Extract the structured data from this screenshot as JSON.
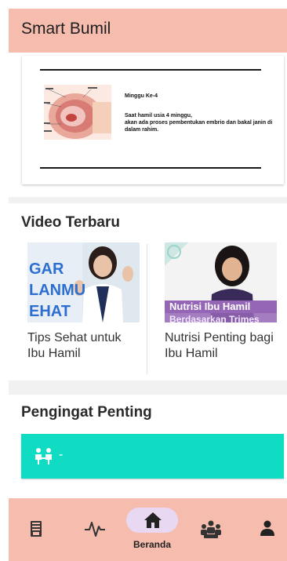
{
  "app": {
    "title": "Smart Bumil"
  },
  "article": {
    "week_title": "Minggu Ke-4",
    "body_line1": "Saat hamil usia 4 minggu,",
    "body_line2": "akan ada proses pembentukan embrio dan bakal janin di dalam rahim."
  },
  "videos": {
    "section_title": "Video Terbaru",
    "items": [
      {
        "title": "Tips Sehat untuk Ibu Hamil",
        "thumb_text_lines": [
          "GAR",
          "LANMU",
          "EHAT"
        ]
      },
      {
        "title": "Nutrisi Penting bagi Ibu Hamil",
        "thumb_text_lines": [
          "Nutrisi Ibu Hamil",
          "Berdasarkan Trimes"
        ]
      }
    ]
  },
  "reminder": {
    "section_title": "Pengingat Penting",
    "text": "-",
    "icon": "consultation-icon"
  },
  "bottom_nav": {
    "items": [
      {
        "icon": "book-icon"
      },
      {
        "icon": "heartbeat-icon"
      },
      {
        "icon": "home-icon",
        "label": "Beranda",
        "active": true
      },
      {
        "icon": "community-icon"
      },
      {
        "icon": "profile-icon"
      }
    ]
  },
  "colors": {
    "header": "#f6bcae",
    "reminder_card": "#10dcc3",
    "nav_active_pill": "#e9d8f2",
    "background": "#f1f1f1"
  }
}
